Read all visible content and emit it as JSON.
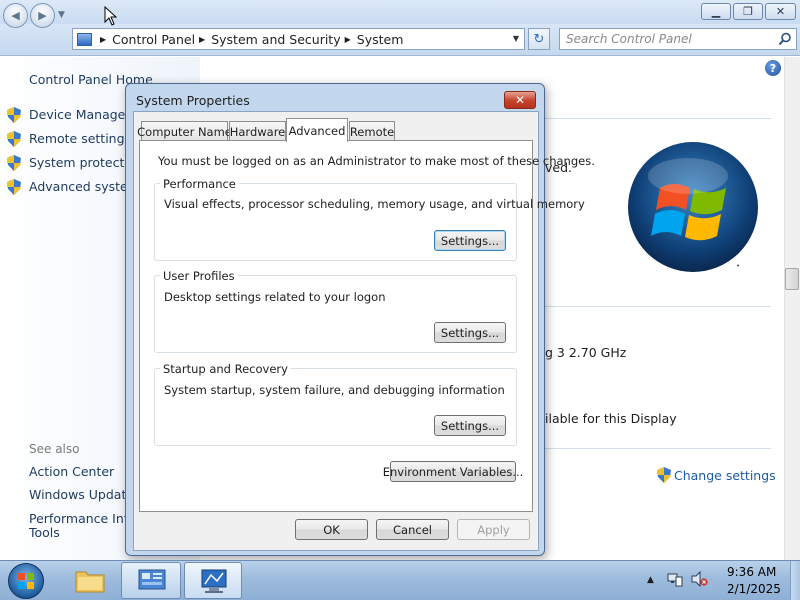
{
  "window": {
    "caption_min": "▁",
    "caption_max": "❐",
    "caption_close": "✕"
  },
  "nav": {
    "breadcrumbs": [
      "Control Panel",
      "System and Security",
      "System"
    ],
    "search_placeholder": "Search Control Panel"
  },
  "left_pane": {
    "home": "Control Panel Home",
    "tasks": [
      "Device Manager",
      "Remote settings",
      "System protection",
      "Advanced system"
    ],
    "see_also_label": "See also",
    "see_also": [
      "Action Center",
      "Windows Update",
      "Performance Infor",
      "Tools"
    ]
  },
  "content": {
    "frag_saved": "ved.",
    "frag_processor": "g 3   2.70 GHz",
    "frag_display": "ilable for this Display",
    "change_settings": "Change settings",
    "help": "?"
  },
  "dialog": {
    "title": "System Properties",
    "close": "✕",
    "tabs": [
      "Computer Name",
      "Hardware",
      "Advanced",
      "Remote"
    ],
    "active_tab": "Advanced",
    "admin_note": "You must be logged on as an Administrator to make most of these changes.",
    "groups": [
      {
        "label": "Performance",
        "desc": "Visual effects, processor scheduling, memory usage, and virtual memory",
        "button": "Settings..."
      },
      {
        "label": "User Profiles",
        "desc": "Desktop settings related to your logon",
        "button": "Settings..."
      },
      {
        "label": "Startup and Recovery",
        "desc": "System startup, system failure, and debugging information",
        "button": "Settings..."
      }
    ],
    "env_button": "Environment Variables...",
    "ok": "OK",
    "cancel": "Cancel",
    "apply": "Apply"
  },
  "taskbar": {
    "time": "9:36 AM",
    "date": "2/1/2025",
    "tray_arrow": "▲"
  },
  "colors": {
    "link": "#1c5ba8",
    "dialog_frame": "#c2d7ee",
    "close_red": "#c5412b"
  }
}
